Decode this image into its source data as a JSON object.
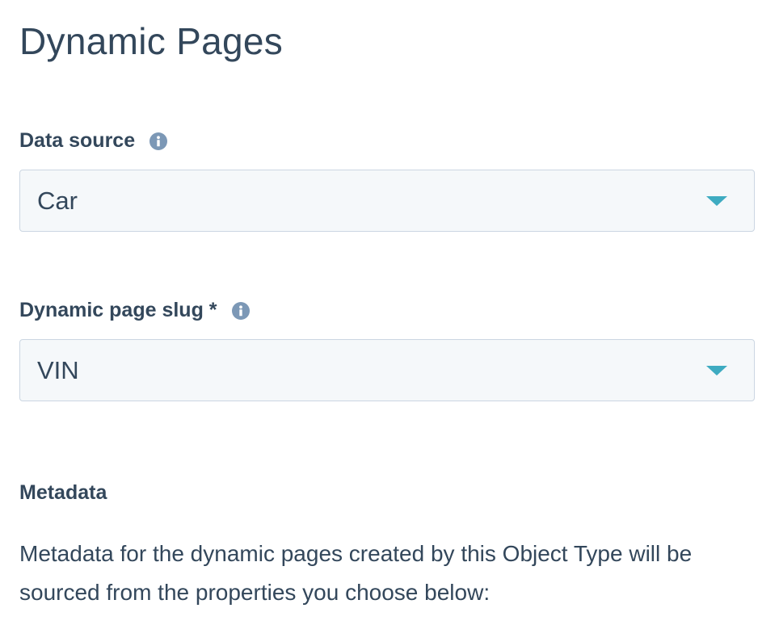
{
  "page": {
    "title": "Dynamic Pages"
  },
  "data_source": {
    "label": "Data source",
    "info_icon": "info-icon",
    "selected_value": "Car",
    "dropdown_icon": "caret-down-icon"
  },
  "slug": {
    "label": "Dynamic page slug *",
    "info_icon": "info-icon",
    "selected_value": "VIN",
    "dropdown_icon": "caret-down-icon"
  },
  "metadata": {
    "heading": "Metadata",
    "description": "Metadata for the dynamic pages created by this Object Type will be sourced from the properties you choose below:"
  },
  "colors": {
    "text": "#33475b",
    "select_background": "#f5f8fa",
    "select_border": "#cbd6e2",
    "accent": "#0091ae",
    "info_icon": "#7c98b6"
  }
}
